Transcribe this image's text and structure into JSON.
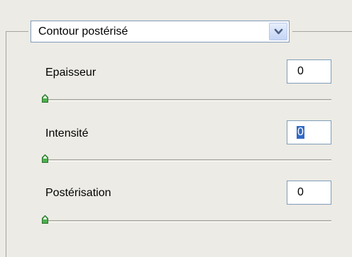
{
  "effect_dropdown": {
    "selected": "Contour postérisé",
    "arrow_icon": "chevron-down-icon"
  },
  "controls": [
    {
      "label": "Epaisseur",
      "value": "0",
      "slider_level": 0
    },
    {
      "label": "Intensité",
      "value": "0",
      "slider_level": 0
    },
    {
      "label": "Postérisation",
      "value": "0",
      "slider_level": 0
    }
  ],
  "colors": {
    "background": "#ecebe5",
    "field_border": "#7f9db9",
    "selection": "#316ac5",
    "thumb": "#4bb04b"
  }
}
